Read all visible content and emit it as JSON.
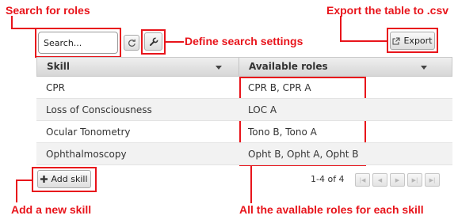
{
  "annotations": {
    "search": "Search for roles",
    "export": "Export the table to .csv",
    "settings": "Define search settings",
    "add": "Add a new skill",
    "roles": "All the avallable roles for each skill"
  },
  "toolbar": {
    "search_placeholder": "Search...",
    "refresh_icon": "refresh-icon",
    "settings_icon": "wrench-icon",
    "export_label": "Export",
    "export_icon": "external-link-icon"
  },
  "table": {
    "columns": [
      "Skill",
      "Available roles"
    ],
    "rows": [
      [
        "CPR",
        "CPR B, CPR A"
      ],
      [
        "Loss of Consciousness",
        "LOC A"
      ],
      [
        "Ocular Tonometry",
        "Tono B, Tono A"
      ],
      [
        "Ophthalmoscopy",
        "Opht B, Opht A, Opht B"
      ]
    ]
  },
  "footer": {
    "add_label": "Add skill",
    "add_icon": "plus-icon",
    "page_info": "1-4 of 4",
    "pager_icons": [
      "first-page-icon",
      "prev-page-icon",
      "next-page-icon",
      "last-page-icon",
      "end-page-icon"
    ]
  },
  "colors": {
    "annotation": "#e8141b"
  }
}
